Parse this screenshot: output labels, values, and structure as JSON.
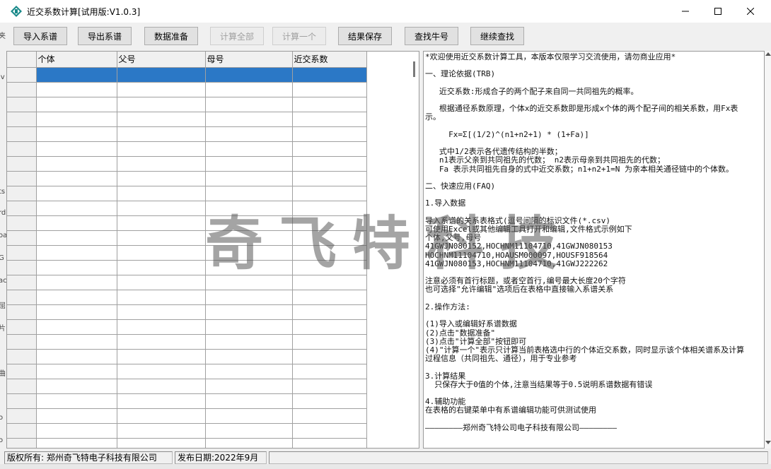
{
  "window": {
    "title": "近交系数计算[试用版:V1.0.3]",
    "icon": "app-icon",
    "controls": [
      "minimize-icon",
      "maximize-icon",
      "close-icon"
    ]
  },
  "toolbar": {
    "buttons": [
      {
        "label": "导入系谱",
        "enabled": true
      },
      {
        "label": "导出系谱",
        "enabled": true
      },
      {
        "label": "数据准备",
        "enabled": true
      },
      {
        "label": "计算全部",
        "enabled": false
      },
      {
        "label": "计算一个",
        "enabled": false
      },
      {
        "label": "结果保存",
        "enabled": true
      },
      {
        "label": "查找牛号",
        "enabled": true
      },
      {
        "label": "继续查找",
        "enabled": true
      }
    ]
  },
  "grid": {
    "columns": [
      "个体",
      "父号",
      "母号",
      "近交系数"
    ],
    "selected_row": 1
  },
  "info": {
    "lines": [
      "*欢迎使用近交系数计算工具，本版本仅限学习交流使用，请勿商业应用*",
      "",
      "一、理论依据(TRB)",
      "",
      "   近交系数:形成合子的两个配子来自同一共同祖先的概率。",
      "",
      "   根据通径系数原理，个体x的近交系数即是形成x个体的两个配子间的相关系数，用Fx表示。",
      "",
      "     Fx=Σ[(1/2)^(n1+n2+1) * (1+Fa)]",
      "",
      "   式中1/2表示各代遗传结构的半数；",
      "   n1表示父亲到共同祖先的代数； n2表示母亲到共同祖先的代数；",
      "   Fa 表示共同祖先自身的式中近交系数；n1+n2+1=N 为亲本相关通径链中的个体数。",
      "",
      "二、快速应用(FAQ)",
      "",
      "1.导入数据",
      "",
      "导入系谱的关系表格式(逗号间隔的标识文件(*.csv)",
      "可使用Excel或其他编辑工具打开和编辑,文件格式示例如下",
      "个体,父号,母号",
      "41GWJN080152,HOCHNM11104710,41GWJN080153",
      "HOCHNM11104710,HOAUSM000097,HOUSF918564",
      "41GWJN080153,HOCHNM11104710,41GWJ222262",
      "",
      "注意必须有首行标题，或者空首行,编号最大长度20个字符",
      "也可选择\"允许编辑\"选项后在表格中直接输入系谱关系",
      "",
      "2.操作方法:",
      "",
      "(1)导入或编辑好系谱数据",
      "(2)点击\"数据准备\"",
      "(3)点击\"计算全部\"按钮即可",
      "(4)\"计算一个\"表示只计算当前表格选中行的个体近交系数，同时显示该个体相关谱系及计算过程信息（共同祖先、通径），用于专业参考",
      "",
      "3.计算结果",
      "  只保存大于0值的个体,注意当结果等于0.5说明系谱数据有错误",
      "",
      "4.辅助功能",
      "在表格的右键菜单中有系谱编辑功能可供测试使用",
      "",
      "————————郑州奇飞特公司电子科技有限公司————————"
    ]
  },
  "watermark": "奇飞特科技",
  "status": {
    "copyright": "版权所有: 郑州奇飞特电子科技有限公司",
    "release_date": "发布日期:2022年9月"
  },
  "colors": {
    "selection": "#2b78c6",
    "window_bg": "#f0f0f0"
  }
}
